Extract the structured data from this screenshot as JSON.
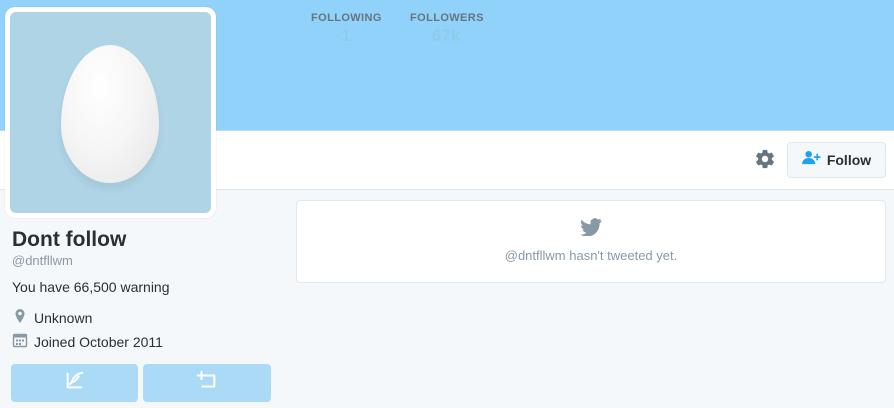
{
  "profile": {
    "name": "Dont follow",
    "handle": "@dntfllwm",
    "bio": "You have 66,500 warning",
    "location": "Unknown",
    "joined": "Joined October 2011"
  },
  "nav": {
    "following_label": "FOLLOWING",
    "following_count": "1",
    "followers_label": "FOLLOWERS",
    "followers_count": "67k"
  },
  "actions": {
    "follow_label": "Follow"
  },
  "timeline": {
    "empty_message": "@dntfllwm hasn't tweeted yet."
  },
  "icons": {
    "settings": "gear-icon",
    "follow": "add-user-icon",
    "location": "map-pin-icon",
    "joined": "calendar-icon",
    "tweet_to": "quill-icon",
    "message": "message-icon",
    "timeline": "twitter-bird-icon"
  },
  "colors": {
    "banner": "#91d2fa",
    "avatar_bg": "#aed4e6",
    "accent": "#8ecbea",
    "action_button": "#abdaf7",
    "page_bg": "#f5f8fa"
  }
}
